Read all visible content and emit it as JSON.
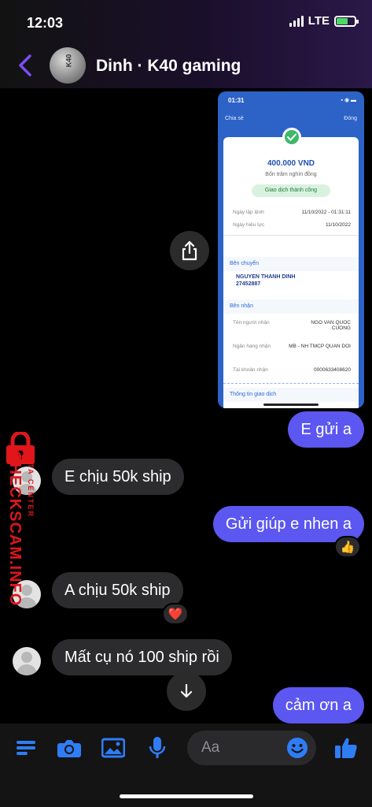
{
  "status": {
    "time": "12:03",
    "network": "LTE"
  },
  "header": {
    "contact_name": "Dinh · K40 gaming",
    "avatar_text": "K40"
  },
  "receipt": {
    "time": "01:31",
    "share_label": "Chia sẻ",
    "close_label": "Đóng",
    "amount": "400.000 VND",
    "amount_words": "Bốn trăm nghìn đồng",
    "status": "Giao dịch thành công",
    "order_date_label": "Ngày lập lệnh",
    "order_date_value": "11/10/2022 - 01:31:11",
    "effective_date_label": "Ngày hiệu lực",
    "effective_date_value": "11/10/2022",
    "sender_section": "Bên chuyển",
    "sender_name": "NGUYEN THANH DINH",
    "sender_account": "27452887",
    "receiver_section": "Bên nhận",
    "receiver_name_label": "Tên người nhận",
    "receiver_name_value": "NGO VAN QUOC CUONG",
    "receiver_bank_label": "Ngân hàng nhận",
    "receiver_bank_value": "MB - NH TMCP QUAN DOI",
    "receiver_account_label": "Tài khoản nhận",
    "receiver_account_value": "0000633408620",
    "transaction_info": "Thông tin giao dịch"
  },
  "messages": [
    {
      "id": "m1",
      "side": "out",
      "text": "E gửi a"
    },
    {
      "id": "m2",
      "side": "in",
      "text": "E chịu 50k ship"
    },
    {
      "id": "m3",
      "side": "out",
      "text": "Gửi giúp e nhen a",
      "reaction": "👍"
    },
    {
      "id": "m4",
      "side": "in",
      "text": "A chịu 50k ship",
      "reaction": "❤️"
    },
    {
      "id": "m5",
      "side": "in",
      "text": "Mất cụ nó 100 ship rồi"
    },
    {
      "id": "m6",
      "side": "out",
      "text": "cảm ơn a"
    }
  ],
  "watermark": {
    "main": "CHECKSCAM.INFO",
    "sub": "DATA CENTER"
  },
  "composer": {
    "placeholder": "Aa"
  },
  "colors": {
    "accent": "#5b57f0",
    "icon_blue": "#2f7df6",
    "incoming_bubble": "#2c2c2e",
    "watermark_red": "#e0161b"
  }
}
